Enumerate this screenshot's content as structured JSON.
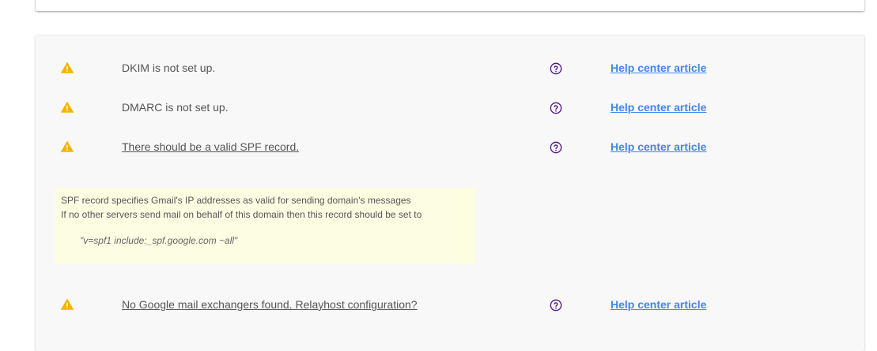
{
  "colors": {
    "warning": "#f4b400",
    "link": "#4285f4",
    "help_icon": "#4a148c",
    "info_box_bg": "#fdfde2",
    "card_bg": "#f8f8f8"
  },
  "icons": {
    "warning": "warning-triangle-icon",
    "help": "help-circle-icon"
  },
  "checks": [
    {
      "text": "DKIM is not set up.",
      "is_link": false,
      "help_label": "Help center article"
    },
    {
      "text": "DMARC is not set up.",
      "is_link": false,
      "help_label": "Help center article"
    },
    {
      "text": "There should be a valid SPF record.",
      "is_link": true,
      "help_label": "Help center article"
    },
    {
      "text": "No Google mail exchangers found. Relayhost configuration?",
      "is_link": true,
      "help_label": "Help center article"
    }
  ],
  "spf_info": {
    "line1": "SPF record specifies Gmail's IP addresses as valid for sending domain's messages",
    "line2": "If no other servers send mail on behalf of this domain then this record should be set to",
    "record": "\"v=spf1 include:_spf.google.com ~all\""
  }
}
